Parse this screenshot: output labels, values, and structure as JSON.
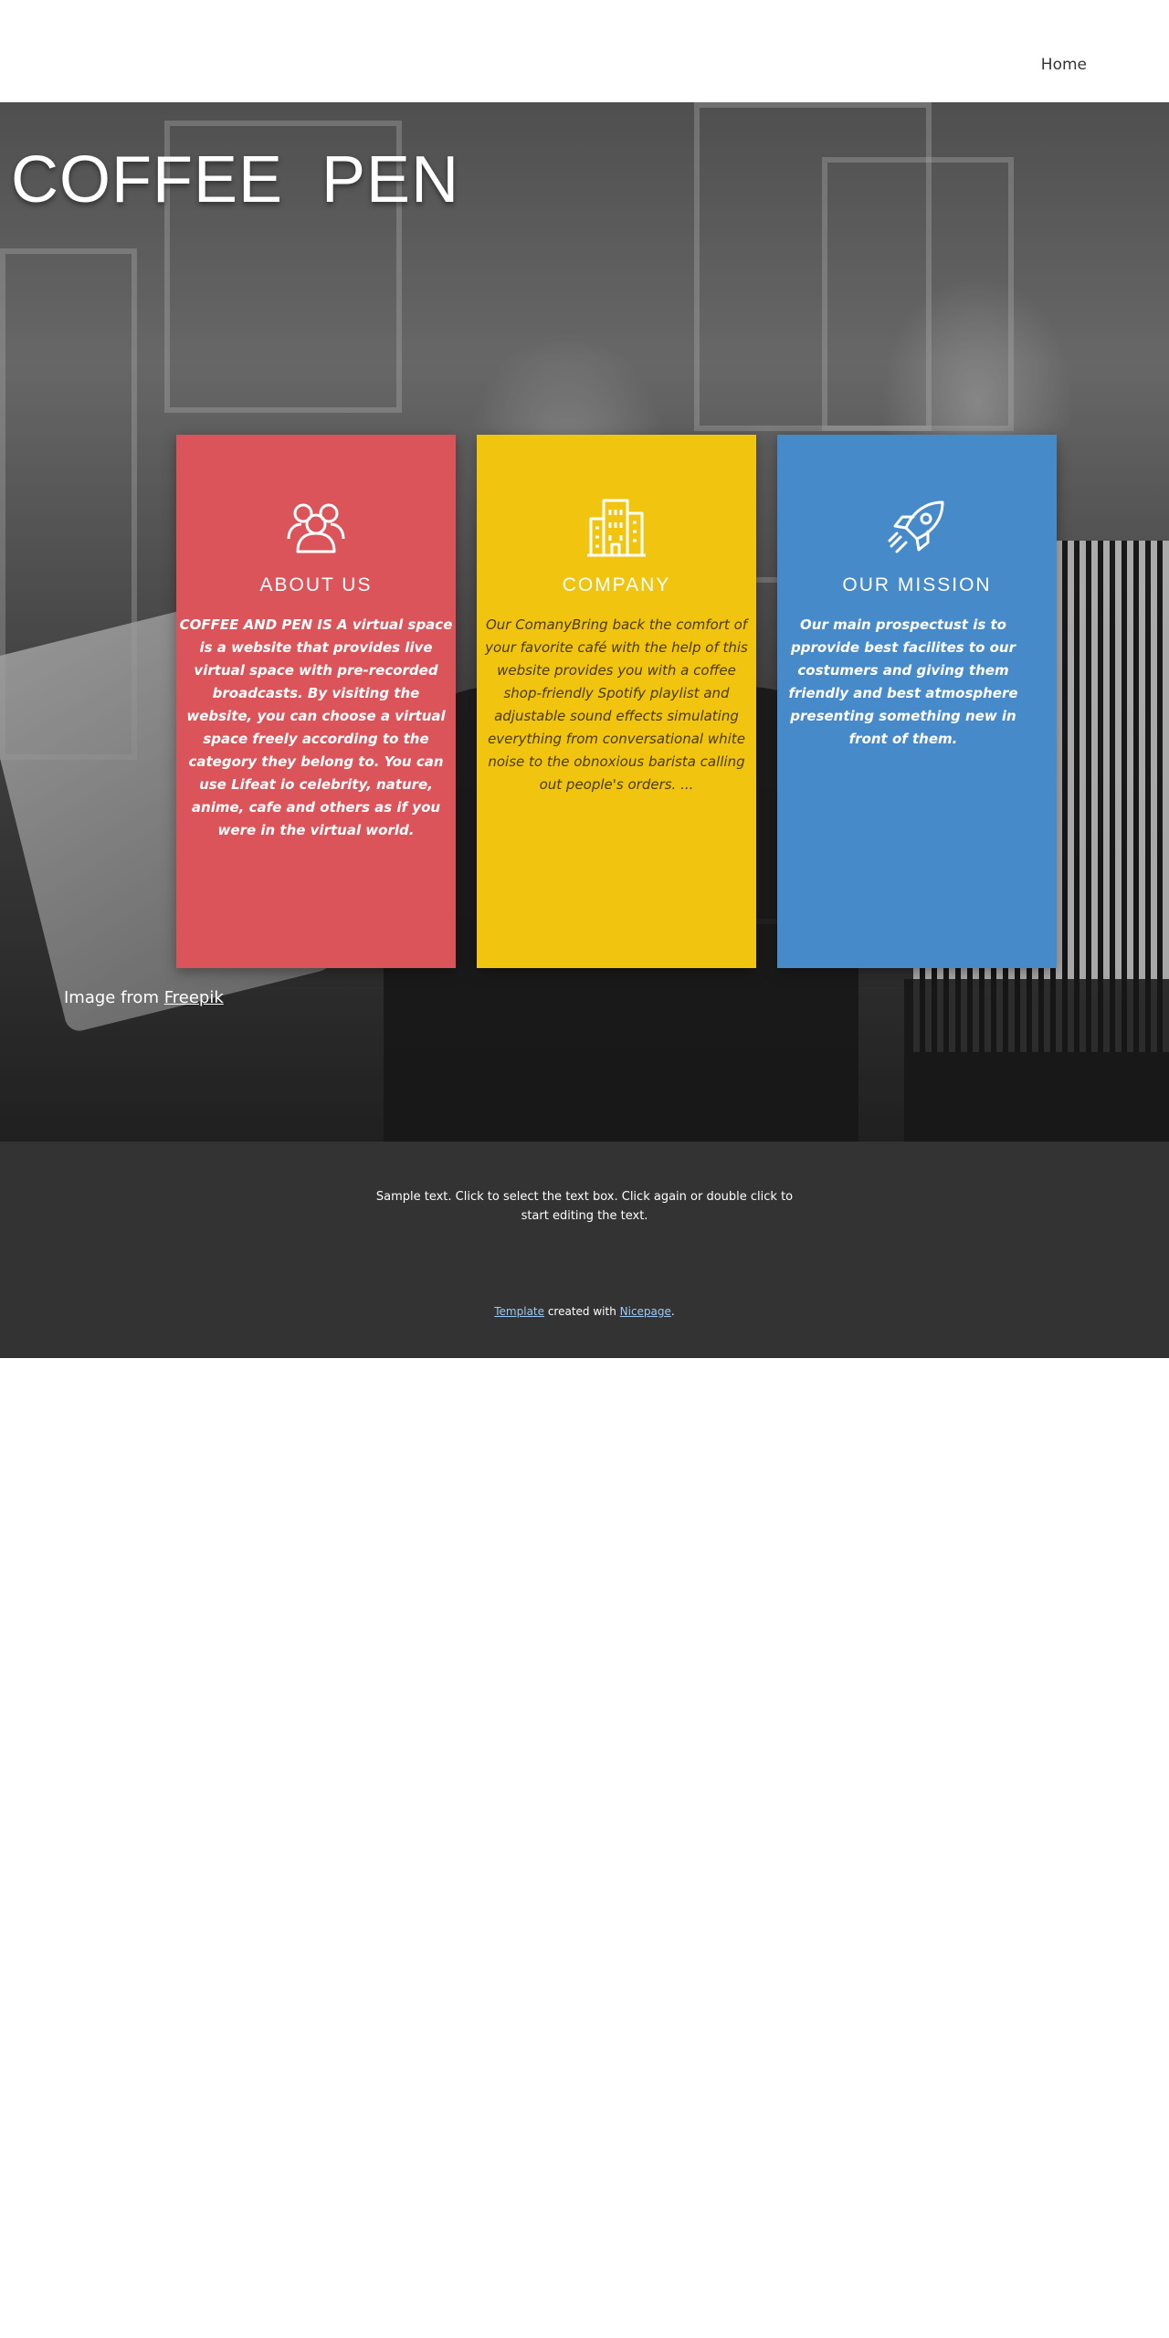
{
  "header": {
    "nav_home": "Home"
  },
  "hero": {
    "title": "COFFEE  PEN",
    "credit_prefix": "Image from ",
    "credit_link": "Freepik"
  },
  "cards": [
    {
      "icon": "people-icon",
      "title": "ABOUT US",
      "text": "COFFEE AND PEN IS A virtual space is a website that provides live virtual space with pre-recorded broadcasts. By visiting the website, you can choose a virtual space freely according to the category they belong to. You can use Lifeat io celebrity, nature, anime, cafe and others as if you were in the virtual world.",
      "color": "#db545a"
    },
    {
      "icon": "building-icon",
      "title": "COMPANY",
      "text": "Our ComanyBring back the comfort of your favorite café with the help of this website provides you with a coffee shop-friendly Spotify playlist and adjustable sound effects simulating everything from conversational white noise to the obnoxious barista calling out people's orders. ...",
      "color": "#f1c40f"
    },
    {
      "icon": "rocket-icon",
      "title": "OUR MISSION",
      "text": "Our main prospectust is to pprovide best facilites to our costumers and giving them friendly and best atmosphere  presenting something new in front of them.",
      "color": "#478ac9"
    }
  ],
  "footer": {
    "text": "Sample text. Click to select the text box. Click again or double click to start editing the text.",
    "template_link": "Template",
    "created_with": " created with ",
    "nicepage_link": "Nicepage",
    "period": "."
  }
}
